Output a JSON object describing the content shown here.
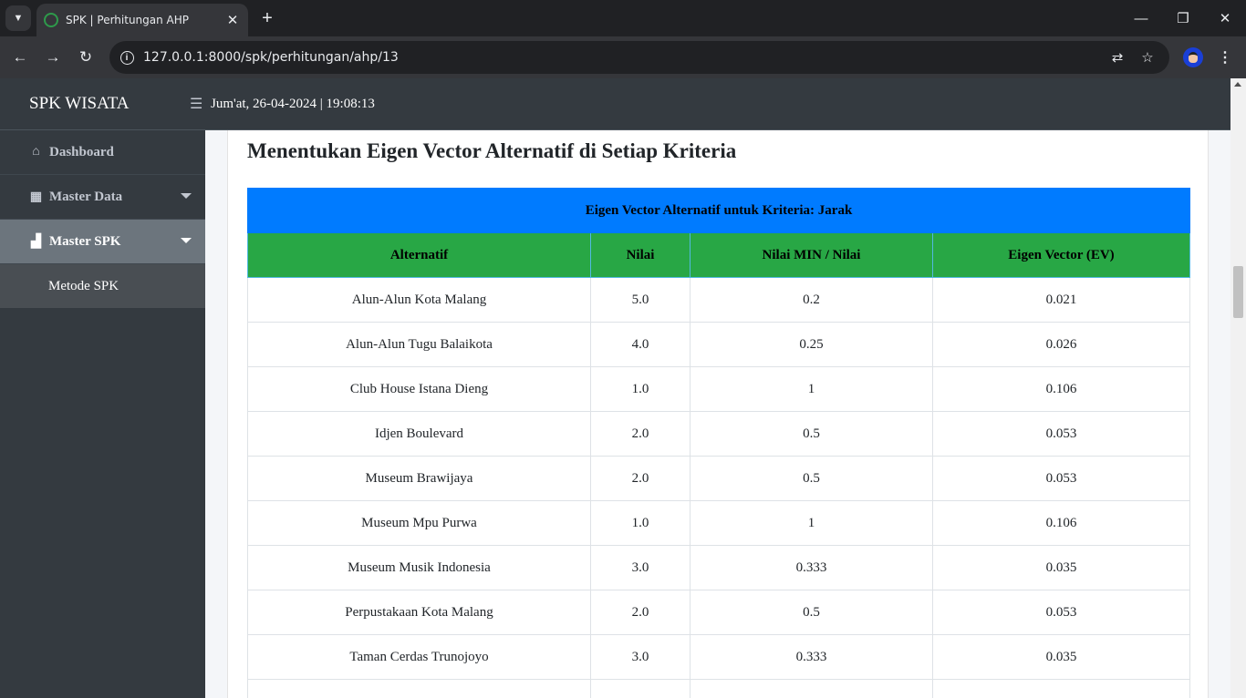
{
  "browser": {
    "tab_title": "SPK | Perhitungan AHP",
    "url": "127.0.0.1:8000/spk/perhitungan/ahp/13",
    "new_tab": "+",
    "close_tab": "✕",
    "minimize": "—",
    "maximize": "❐",
    "close_window": "✕"
  },
  "app": {
    "brand": "SPK WISATA",
    "datetime": "Jum'at, 26-04-2024 | 19:08:13"
  },
  "sidebar": {
    "items": [
      {
        "label": "Dashboard",
        "icon": "home-icon"
      },
      {
        "label": "Master Data",
        "icon": "cubes-icon"
      },
      {
        "label": "Master SPK",
        "icon": "sitemap-icon"
      }
    ],
    "submenu": {
      "label": "Metode SPK"
    }
  },
  "main": {
    "section_title": "Menentukan Eigen Vector Alternatif di Setiap Kriteria",
    "table": {
      "caption": "Eigen Vector Alternatif untuk Kriteria: Jarak",
      "headers": [
        "Alternatif",
        "Nilai",
        "Nilai MIN / Nilai",
        "Eigen Vector (EV)"
      ],
      "rows": [
        [
          "Alun-Alun Kota Malang",
          "5.0",
          "0.2",
          "0.021"
        ],
        [
          "Alun-Alun Tugu Balaikota",
          "4.0",
          "0.25",
          "0.026"
        ],
        [
          "Club House Istana Dieng",
          "1.0",
          "1",
          "0.106"
        ],
        [
          "Idjen Boulevard",
          "2.0",
          "0.5",
          "0.053"
        ],
        [
          "Museum Brawijaya",
          "2.0",
          "0.5",
          "0.053"
        ],
        [
          "Museum Mpu Purwa",
          "1.0",
          "1",
          "0.106"
        ],
        [
          "Museum Musik Indonesia",
          "3.0",
          "0.333",
          "0.035"
        ],
        [
          "Perpustakaan Kota Malang",
          "2.0",
          "0.5",
          "0.053"
        ],
        [
          "Taman Cerdas Trunojoyo",
          "3.0",
          "0.333",
          "0.035"
        ],
        [
          "",
          "",
          "",
          ""
        ]
      ]
    }
  },
  "colors": {
    "caption_bg": "#007bff",
    "header_bg": "#28a745",
    "sidebar_bg": "#343a40",
    "active_item_bg": "#6c757d"
  }
}
